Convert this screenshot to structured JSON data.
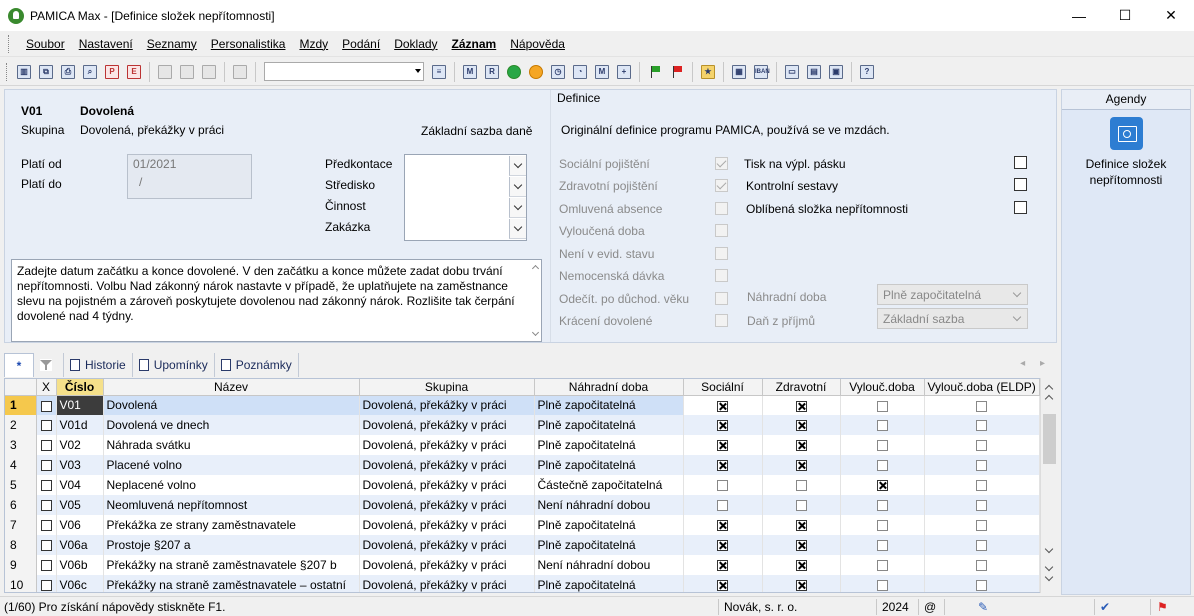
{
  "window": {
    "title": "PAMICA Max - [Definice složek nepřítomnosti]",
    "controls": {
      "minimize": "—",
      "maximize": "☐",
      "close": "✕"
    }
  },
  "menu": [
    "Soubor",
    "Nastavení",
    "Seznamy",
    "Personalistika",
    "Mzdy",
    "Podání",
    "Doklady",
    "Záznam",
    "Nápověda"
  ],
  "menu_bold": "Záznam",
  "toolbar": {
    "combo_value": "",
    "icons": [
      "table-detail-icon",
      "copy-icon",
      "print-icon",
      "preview-icon",
      "pdf-icon",
      "export-icon",
      "new-record-icon",
      "duplicate-icon",
      "delete-icon",
      "save-icon",
      "filter-icon",
      "m-icon",
      "r-icon",
      "green-circle-icon",
      "orange-person-icon",
      "clock-icon",
      "history-icon",
      "m2-icon",
      "add-icon",
      "green-flag-icon",
      "red-flag-icon",
      "folder-star-icon",
      "calculator-icon",
      "iban-icon",
      "monitor-icon",
      "window-icon",
      "cards-icon",
      "help-icon"
    ]
  },
  "detail": {
    "code": "V01",
    "name": "Dovolená",
    "group_label": "Skupina",
    "group_value": "Dovolená, překážky v práci",
    "base_rate_label": "Základní sazba daně",
    "valid_from_label": "Platí od",
    "valid_to_label": "Platí do",
    "valid_from_value": "01/2021",
    "valid_to_value": "/",
    "predkontace_label": "Předkontace",
    "stredisko_label": "Středisko",
    "cinnost_label": "Činnost",
    "zakazka_label": "Zakázka",
    "help_text": "Zadejte datum začátku a konce dovolené. V den začátku a konce můžete zadat dobu trvání nepřítomnosti. Volbu Nad zákonný nárok nastavte v případě, že uplatňujete na zaměstnance slevu na pojistném a zároveň poskytujete dovolenou nad zákonný nárok. Rozlišite tak čerpání dovolené nad 4 týdny.",
    "definice_label": "Definice",
    "definice_text": "Originální definice programu PAMICA, používá se ve mzdách.",
    "flags_left": [
      {
        "label": "Sociální pojištění",
        "checked": true
      },
      {
        "label": "Zdravotní pojištění",
        "checked": true
      },
      {
        "label": "Omluvená absence",
        "checked": false
      },
      {
        "label": "Vyloučená doba",
        "checked": false
      },
      {
        "label": "Není v evid. stavu",
        "checked": false
      },
      {
        "label": "Nemocenská dávka",
        "checked": false
      },
      {
        "label": "Odečít. po důchod. věku",
        "checked": false
      },
      {
        "label": "Krácení dovolené",
        "checked": false
      }
    ],
    "flags_right": [
      {
        "label": "Tisk na výpl. pásku",
        "checked": false
      },
      {
        "label": "Kontrolní sestavy",
        "checked": false
      },
      {
        "label": "Oblíbená složka nepřítomnosti",
        "checked": false
      }
    ],
    "nahradni_doba_label": "Náhradní doba",
    "nahradni_doba_value": "Plně započitatelná",
    "dan_label": "Daň z příjmů",
    "dan_value": "Základní sazba"
  },
  "agendy": {
    "header": "Agendy",
    "item_label": "Definice složek nepřítomnosti"
  },
  "tabs": {
    "first": "*",
    "historie": "Historie",
    "upominky": "Upomínky",
    "poznamky": "Poznámky",
    "nav": "◂ ▸"
  },
  "grid": {
    "columns": [
      "X",
      "Číslo",
      "Název",
      "Skupina",
      "Náhradní doba",
      "Sociální",
      "Zdravotní",
      "Vylouč.doba",
      "Vylouč.doba (ELDP)"
    ],
    "rows": [
      {
        "n": "1",
        "code": "V01",
        "name": "Dovolená",
        "group": "Dovolená, překážky v práci",
        "nd": "Plně započitatelná",
        "soc": true,
        "zdr": true,
        "vd": false,
        "vde": false
      },
      {
        "n": "2",
        "code": "V01d",
        "name": "Dovolená ve dnech",
        "group": "Dovolená, překážky v práci",
        "nd": "Plně započitatelná",
        "soc": true,
        "zdr": true,
        "vd": false,
        "vde": false
      },
      {
        "n": "3",
        "code": "V02",
        "name": "Náhrada svátku",
        "group": "Dovolená, překážky v práci",
        "nd": "Plně započitatelná",
        "soc": true,
        "zdr": true,
        "vd": false,
        "vde": false
      },
      {
        "n": "4",
        "code": "V03",
        "name": "Placené volno",
        "group": "Dovolená, překážky v práci",
        "nd": "Plně započitatelná",
        "soc": true,
        "zdr": true,
        "vd": false,
        "vde": false
      },
      {
        "n": "5",
        "code": "V04",
        "name": "Neplacené volno",
        "group": "Dovolená, překážky v práci",
        "nd": "Částečně započitatelná",
        "soc": false,
        "zdr": false,
        "vd": true,
        "vde": false
      },
      {
        "n": "6",
        "code": "V05",
        "name": "Neomluvená nepřítomnost",
        "group": "Dovolená, překážky v práci",
        "nd": "Není náhradní dobou",
        "soc": false,
        "zdr": false,
        "vd": false,
        "vde": false
      },
      {
        "n": "7",
        "code": "V06",
        "name": "Překážka ze strany zaměstnavatele",
        "group": "Dovolená, překážky v práci",
        "nd": "Plně započitatelná",
        "soc": true,
        "zdr": true,
        "vd": false,
        "vde": false
      },
      {
        "n": "8",
        "code": "V06a",
        "name": "Prostoje §207 a",
        "group": "Dovolená, překážky v práci",
        "nd": "Plně započitatelná",
        "soc": true,
        "zdr": true,
        "vd": false,
        "vde": false
      },
      {
        "n": "9",
        "code": "V06b",
        "name": "Překážky na straně zaměstnavatele §207 b",
        "group": "Dovolená, překážky v práci",
        "nd": "Není náhradní dobou",
        "soc": true,
        "zdr": true,
        "vd": false,
        "vde": false
      },
      {
        "n": "10",
        "code": "V06c",
        "name": "Překážky na straně zaměstnavatele – ostatní",
        "group": "Dovolená, překážky v práci",
        "nd": "Plně započitatelná",
        "soc": true,
        "zdr": true,
        "vd": false,
        "vde": false
      }
    ]
  },
  "status": {
    "help": "(1/60) Pro získání nápovědy stiskněte F1.",
    "company": "Novák, s. r. o.",
    "year": "2024",
    "at": "@"
  }
}
